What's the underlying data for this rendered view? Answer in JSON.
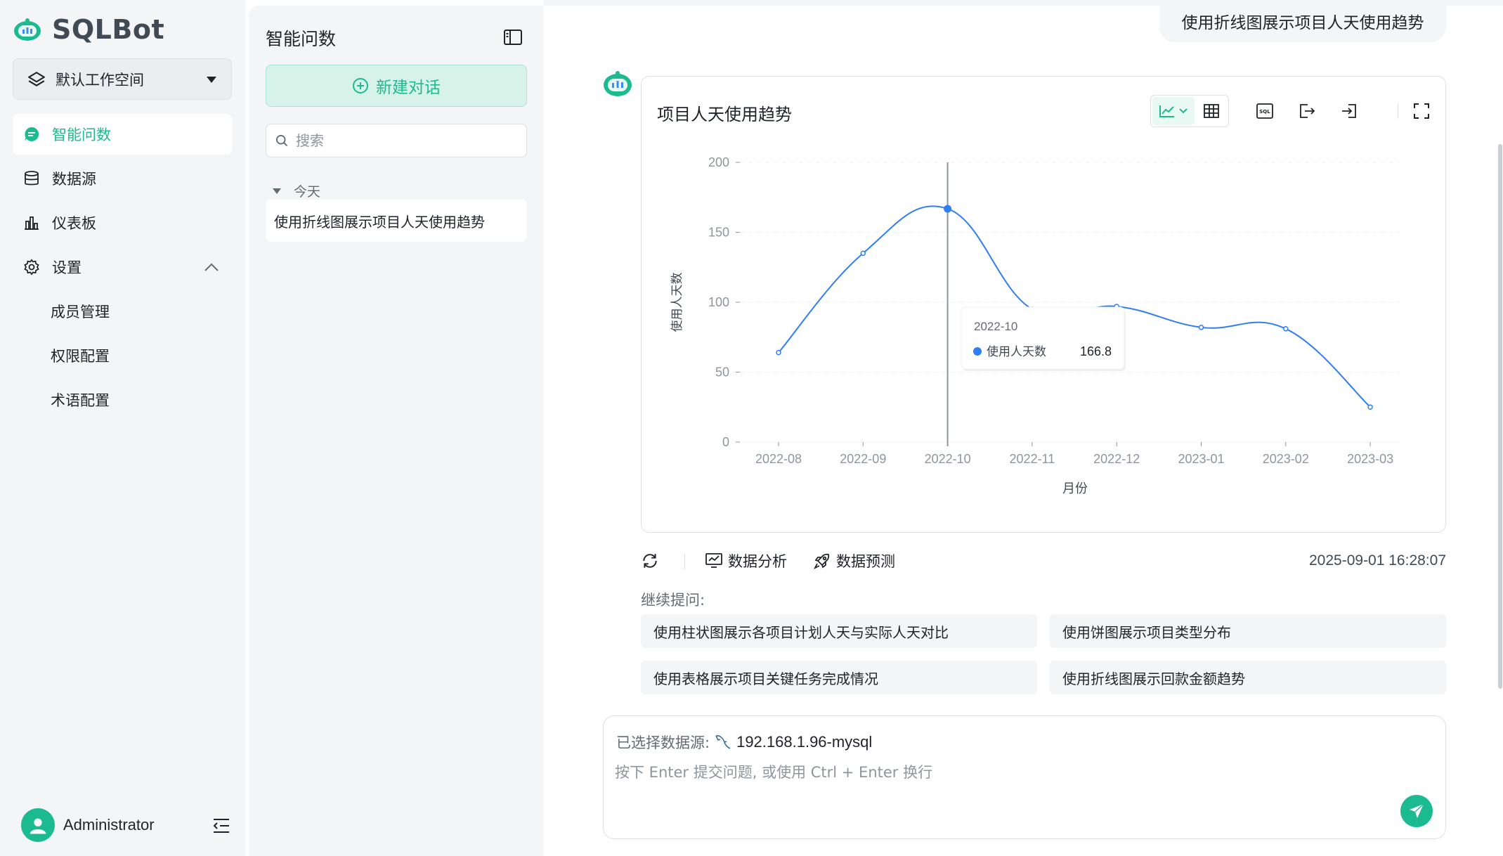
{
  "app": {
    "name": "SQLBot",
    "brand_color": "#1cba90"
  },
  "workspace": {
    "label": "默认工作空间",
    "icon": "layers-icon"
  },
  "nav": {
    "items": [
      {
        "label": "智能问数",
        "icon": "chat-icon",
        "active": true
      },
      {
        "label": "数据源",
        "icon": "database-icon"
      },
      {
        "label": "仪表板",
        "icon": "dashboard-icon"
      },
      {
        "label": "设置",
        "icon": "gear-icon",
        "expanded": true
      }
    ],
    "settings_sub": [
      "成员管理",
      "权限配置",
      "术语配置"
    ]
  },
  "user": {
    "name": "Administrator"
  },
  "history": {
    "title": "智能问数",
    "new_chat_label": "新建对话",
    "search_placeholder": "搜索",
    "group_label": "今天",
    "items": [
      "使用折线图展示项目人天使用趋势"
    ]
  },
  "chat": {
    "user_question": "使用折线图展示项目人天使用趋势",
    "chart_title": "项目人天使用趋势",
    "actions": {
      "analysis": "数据分析",
      "predict": "数据预测"
    },
    "timestamp": "2025-09-01 16:28:07",
    "follow_up_label": "继续提问:",
    "suggestions": [
      "使用柱状图展示各项目计划人天与实际人天对比",
      "使用饼图展示项目类型分布",
      "使用表格展示项目关键任务完成情况",
      "使用折线图展示回款金额趋势"
    ],
    "tooltip": {
      "title": "2022-10",
      "series": "使用人天数",
      "value": "166.8"
    }
  },
  "input": {
    "datasource_label": "已选择数据源:",
    "datasource_name": "192.168.1.96-mysql",
    "placeholder": "按下 Enter 提交问题, 或使用 Ctrl + Enter 换行"
  },
  "chart_data": {
    "type": "line",
    "smooth": true,
    "categories": [
      "2022-08",
      "2022-09",
      "2022-10",
      "2022-11",
      "2022-12",
      "2023-01",
      "2023-02",
      "2023-03"
    ],
    "series": [
      {
        "name": "使用人天数",
        "values": [
          64,
          135,
          166.8,
          95,
          97,
          82,
          81,
          25
        ],
        "color": "#2f7ef5"
      }
    ],
    "xlabel": "月份",
    "ylabel": "使用人天数",
    "ylim": [
      0,
      200
    ],
    "yticks": [
      0,
      50,
      100,
      150,
      200
    ],
    "grid": true,
    "highlight_index": 2
  }
}
